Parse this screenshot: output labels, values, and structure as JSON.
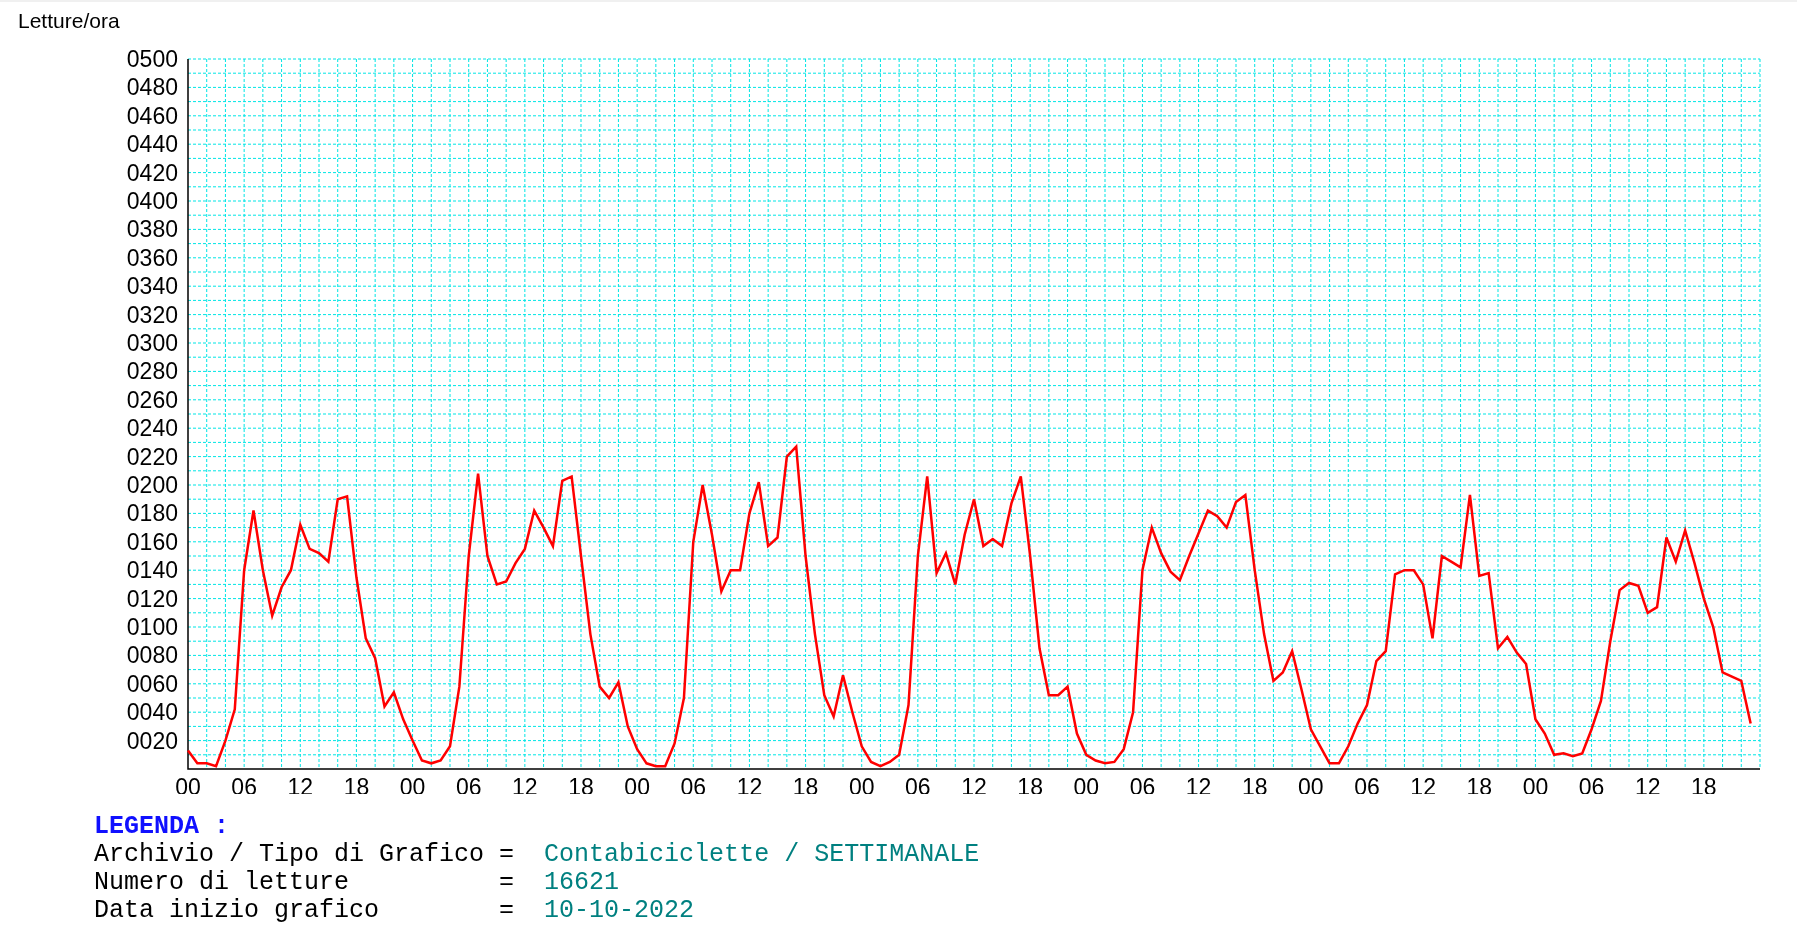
{
  "chart": {
    "chart_data": {
      "type": "line",
      "ylabel": "Letture/ora",
      "grid": true,
      "x": [
        0,
        1,
        2,
        3,
        4,
        5,
        6,
        7,
        8,
        9,
        10,
        11,
        12,
        13,
        14,
        15,
        16,
        17,
        18,
        19,
        20,
        21,
        22,
        23,
        24,
        25,
        26,
        27,
        28,
        29,
        30,
        31,
        32,
        33,
        34,
        35,
        36,
        37,
        38,
        39,
        40,
        41,
        42,
        43,
        44,
        45,
        46,
        47,
        48,
        49,
        50,
        51,
        52,
        53,
        54,
        55,
        56,
        57,
        58,
        59,
        60,
        61,
        62,
        63,
        64,
        65,
        66,
        67,
        68,
        69,
        70,
        71,
        72,
        73,
        74,
        75,
        76,
        77,
        78,
        79,
        80,
        81,
        82,
        83,
        84,
        85,
        86,
        87,
        88,
        89,
        90,
        91,
        92,
        93,
        94,
        95,
        96,
        97,
        98,
        99,
        100,
        101,
        102,
        103,
        104,
        105,
        106,
        107,
        108,
        109,
        110,
        111,
        112,
        113,
        114,
        115,
        116,
        117,
        118,
        119,
        120,
        121,
        122,
        123,
        124,
        125,
        126,
        127,
        128,
        129,
        130,
        131,
        132,
        133,
        134,
        135,
        136,
        137,
        138,
        139,
        140,
        141,
        142,
        143,
        144,
        145,
        146,
        147,
        148,
        149,
        150,
        151,
        152,
        153,
        154,
        155,
        156,
        157,
        158,
        159,
        160,
        161,
        162,
        163,
        164,
        165,
        166,
        167
      ],
      "xlim": [
        0,
        168
      ],
      "ylim": [
        0,
        500
      ],
      "xticks": [
        {
          "value": 0,
          "label": "00"
        },
        {
          "value": 6,
          "label": "06"
        },
        {
          "value": 12,
          "label": "12"
        },
        {
          "value": 18,
          "label": "18"
        },
        {
          "value": 24,
          "label": "00"
        },
        {
          "value": 30,
          "label": "06"
        },
        {
          "value": 36,
          "label": "12"
        },
        {
          "value": 42,
          "label": "18"
        },
        {
          "value": 48,
          "label": "00"
        },
        {
          "value": 54,
          "label": "06"
        },
        {
          "value": 60,
          "label": "12"
        },
        {
          "value": 66,
          "label": "18"
        },
        {
          "value": 72,
          "label": "00"
        },
        {
          "value": 78,
          "label": "06"
        },
        {
          "value": 84,
          "label": "12"
        },
        {
          "value": 90,
          "label": "18"
        },
        {
          "value": 96,
          "label": "00"
        },
        {
          "value": 102,
          "label": "06"
        },
        {
          "value": 108,
          "label": "12"
        },
        {
          "value": 114,
          "label": "18"
        },
        {
          "value": 120,
          "label": "00"
        },
        {
          "value": 126,
          "label": "06"
        },
        {
          "value": 132,
          "label": "12"
        },
        {
          "value": 138,
          "label": "18"
        },
        {
          "value": 144,
          "label": "00"
        },
        {
          "value": 150,
          "label": "06"
        },
        {
          "value": 156,
          "label": "12"
        },
        {
          "value": 162,
          "label": "18"
        }
      ],
      "yticks": [
        {
          "value": 20,
          "label": "0020"
        },
        {
          "value": 40,
          "label": "0040"
        },
        {
          "value": 60,
          "label": "0060"
        },
        {
          "value": 80,
          "label": "0080"
        },
        {
          "value": 100,
          "label": "0100"
        },
        {
          "value": 120,
          "label": "0120"
        },
        {
          "value": 140,
          "label": "0140"
        },
        {
          "value": 160,
          "label": "0160"
        },
        {
          "value": 180,
          "label": "0180"
        },
        {
          "value": 200,
          "label": "0200"
        },
        {
          "value": 220,
          "label": "0220"
        },
        {
          "value": 240,
          "label": "0240"
        },
        {
          "value": 260,
          "label": "0260"
        },
        {
          "value": 280,
          "label": "0280"
        },
        {
          "value": 300,
          "label": "0300"
        },
        {
          "value": 320,
          "label": "0320"
        },
        {
          "value": 340,
          "label": "0340"
        },
        {
          "value": 360,
          "label": "0360"
        },
        {
          "value": 380,
          "label": "0380"
        },
        {
          "value": 400,
          "label": "0400"
        },
        {
          "value": 420,
          "label": "0420"
        },
        {
          "value": 440,
          "label": "0440"
        },
        {
          "value": 460,
          "label": "0460"
        },
        {
          "value": 480,
          "label": "0480"
        },
        {
          "value": 500,
          "label": "0500"
        }
      ],
      "series": [
        {
          "color": "#ff0000",
          "values": [
            13,
            4,
            4,
            2,
            20,
            42,
            140,
            182,
            140,
            108,
            128,
            140,
            172,
            155,
            152,
            146,
            190,
            192,
            135,
            92,
            78,
            44,
            54,
            35,
            20,
            6,
            4,
            6,
            16,
            58,
            150,
            208,
            150,
            130,
            132,
            145,
            155,
            182,
            170,
            157,
            203,
            206,
            150,
            95,
            58,
            50,
            61,
            30,
            14,
            4,
            2,
            2,
            18,
            50,
            160,
            200,
            165,
            125,
            140,
            140,
            180,
            202,
            157,
            163,
            220,
            227,
            150,
            95,
            52,
            37,
            66,
            40,
            16,
            5,
            2,
            5,
            10,
            45,
            150,
            206,
            138,
            152,
            130,
            165,
            190,
            157,
            162,
            157,
            187,
            206,
            150,
            85,
            52,
            52,
            58,
            25,
            10,
            6,
            4,
            5,
            14,
            40,
            140,
            170,
            152,
            139,
            133,
            150,
            166,
            182,
            178,
            170,
            188,
            193,
            140,
            95,
            62,
            68,
            83,
            56,
            28,
            16,
            4,
            4,
            16,
            32,
            45,
            76,
            83,
            137,
            140,
            140,
            130,
            92,
            150,
            146,
            142,
            193,
            136,
            138,
            85,
            93,
            82,
            74,
            35,
            25,
            10,
            11,
            9,
            11,
            28,
            48,
            90,
            126,
            131,
            129,
            110,
            114,
            163,
            146,
            168,
            145,
            120,
            100,
            68,
            65,
            62,
            32
          ]
        }
      ]
    }
  },
  "legend": {
    "title": "LEGENDA :",
    "rows": [
      {
        "label": "Archivio / Tipo di Grafico",
        "separator": "=",
        "value": "Contabiciclette / SETTIMANALE"
      },
      {
        "label": "Numero di letture",
        "separator": "=",
        "value": "16621"
      },
      {
        "label": "Data inizio grafico",
        "separator": "=",
        "value": "10-10-2022"
      }
    ]
  }
}
